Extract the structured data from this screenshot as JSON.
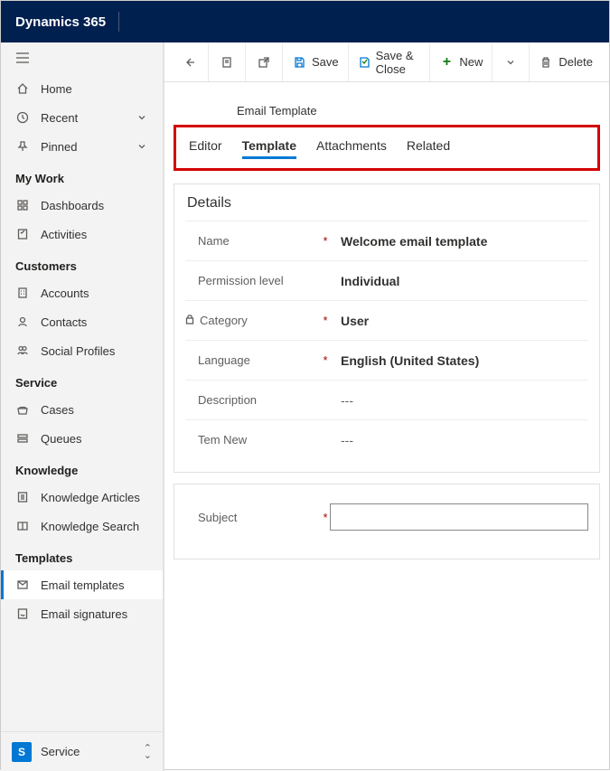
{
  "header": {
    "app_name": "Dynamics 365"
  },
  "sidebar": {
    "top": [
      {
        "label": "Home"
      },
      {
        "label": "Recent"
      },
      {
        "label": "Pinned"
      }
    ],
    "groups": [
      {
        "title": "My Work",
        "items": [
          {
            "label": "Dashboards"
          },
          {
            "label": "Activities"
          }
        ]
      },
      {
        "title": "Customers",
        "items": [
          {
            "label": "Accounts"
          },
          {
            "label": "Contacts"
          },
          {
            "label": "Social Profiles"
          }
        ]
      },
      {
        "title": "Service",
        "items": [
          {
            "label": "Cases"
          },
          {
            "label": "Queues"
          }
        ]
      },
      {
        "title": "Knowledge",
        "items": [
          {
            "label": "Knowledge Articles"
          },
          {
            "label": "Knowledge Search"
          }
        ]
      },
      {
        "title": "Templates",
        "items": [
          {
            "label": "Email templates"
          },
          {
            "label": "Email signatures"
          }
        ]
      }
    ],
    "footer": {
      "badge": "S",
      "label": "Service"
    }
  },
  "commandbar": {
    "save": "Save",
    "save_close": "Save & Close",
    "new": "New",
    "delete": "Delete"
  },
  "record": {
    "entity_label": "Email Template",
    "tabs": [
      "Editor",
      "Template",
      "Attachments",
      "Related"
    ],
    "active_tab": "Template",
    "section_title": "Details",
    "fields": {
      "name": {
        "label": "Name",
        "required": true,
        "value": "Welcome email template"
      },
      "permission": {
        "label": "Permission level",
        "required": false,
        "value": "Individual"
      },
      "category": {
        "label": "Category",
        "required": true,
        "locked": true,
        "value": "User"
      },
      "language": {
        "label": "Language",
        "required": true,
        "value": "English (United States)"
      },
      "description": {
        "label": "Description",
        "required": false,
        "value": "---"
      },
      "tem_new": {
        "label": "Tem New",
        "required": false,
        "value": "---"
      }
    },
    "subject": {
      "label": "Subject",
      "required": true,
      "value": ""
    }
  }
}
